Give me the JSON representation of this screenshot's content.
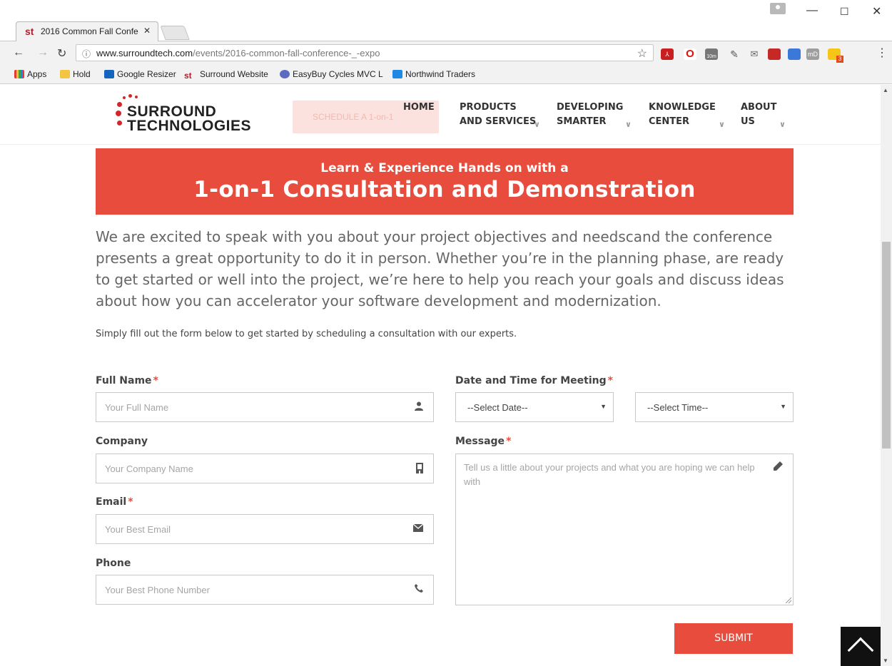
{
  "browser": {
    "tab_title": "2016 Common Fall Confe",
    "tab_favicon_text": "st",
    "url_host": "www.surroundtech.com",
    "url_path": "/events/2016-common-fall-conference-_-expo",
    "bookmarks": [
      "Apps",
      "Hold",
      "Google Resizer",
      "Surround Website",
      "EasyBuy Cycles MVC L",
      "Northwind Traders"
    ],
    "extension_badge_10m": "10m",
    "extension_badge_3": "3",
    "ext_md": "mD"
  },
  "site": {
    "logo_line1": "SURROUND",
    "logo_line2": "TECHNOLOGIES",
    "cta_ghost": "SCHEDULE A 1-on-1",
    "nav": {
      "home": "HOME",
      "products_1": "PRODUCTS",
      "products_2": "AND SERVICES",
      "developing_1": "DEVELOPING",
      "developing_2": "SMARTER",
      "knowledge_1": "KNOWLEDGE",
      "knowledge_2": "CENTER",
      "about_1": "ABOUT",
      "about_2": "US"
    }
  },
  "banner": {
    "subtitle": "Learn & Experience Hands on with a",
    "title": "1-on-1 Consultation and Demonstration"
  },
  "intro": "We are excited to speak with you about your project objectives and needscand the conference presents a great opportunity to do it in person. Whether you’re in the planning phase, are ready to get started or well into the project, we’re here to help you reach your goals and discuss ideas about how you can accelerator your software development and modernization.",
  "instructions": "Simply fill out the form below to get started by scheduling a consultation with our experts.",
  "form": {
    "full_name_label": "Full Name",
    "full_name_placeholder": "Your Full Name",
    "company_label": "Company",
    "company_placeholder": "Your Company Name",
    "email_label": "Email",
    "email_placeholder": "Your Best Email",
    "phone_label": "Phone",
    "phone_placeholder": "Your Best Phone Number",
    "datetime_label": "Date and Time for Meeting",
    "date_value": "--Select Date--",
    "time_value": "--Select Time--",
    "message_label": "Message",
    "message_placeholder": "Tell us a little about your projects and what you are hoping we can help with",
    "required_mark": "*",
    "submit": "SUBMIT"
  },
  "colors": {
    "accent": "#e74c3c",
    "brand_red": "#d3262b"
  },
  "icons": {
    "full_name": "user-icon",
    "company": "building-icon",
    "email": "envelope-icon",
    "phone": "phone-icon",
    "message": "pencil-icon"
  }
}
